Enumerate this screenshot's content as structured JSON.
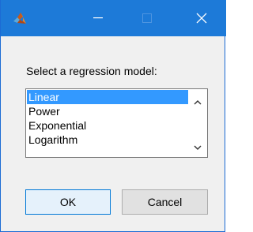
{
  "window": {
    "title": ""
  },
  "titlebar": {
    "app_icon": "matlab-logo-icon",
    "minimize_icon": "minimize-icon",
    "maximize_icon": "maximize-icon",
    "close_icon": "close-icon",
    "color": "#1d7ad8"
  },
  "dialog": {
    "prompt": "Select a regression model:",
    "listbox": {
      "items": [
        "Linear",
        "Power",
        "Exponential",
        "Logarithm"
      ],
      "selected": "Linear",
      "selection_color": "#3399ff"
    },
    "scroll_up_icon": "chevron-up-icon",
    "scroll_down_icon": "chevron-down-icon",
    "buttons": {
      "ok_label": "OK",
      "cancel_label": "Cancel"
    }
  }
}
